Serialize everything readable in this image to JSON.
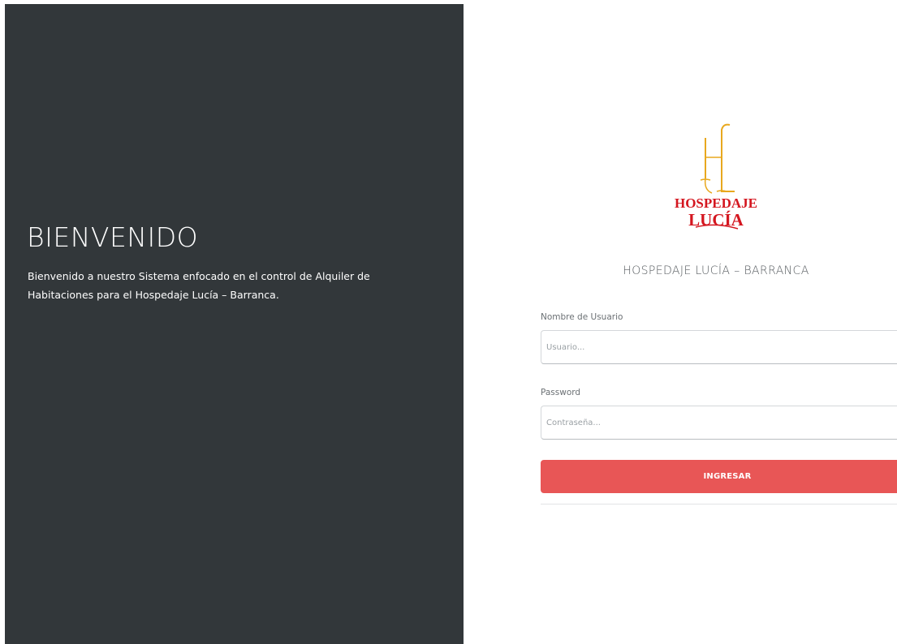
{
  "welcome": {
    "title": "BIENVENIDO",
    "text": "Bienvenido a nuestro Sistema enfocado en el control de Alquiler de Habitaciones para el Hospedaje Lucía – Barranca."
  },
  "logo": {
    "monogram": "HL",
    "line1": "HOSPEDAJE",
    "line2": "LUCÍA",
    "colors": {
      "monogram": "#e8a81e",
      "text": "#d4161f"
    }
  },
  "login": {
    "heading": "HOSPEDAJE LUCÍA – BARRANCA",
    "username_label": "Nombre de Usuario",
    "username_placeholder": "Usuario...",
    "username_value": "",
    "password_label": "Password",
    "password_placeholder": "Contraseña...",
    "password_value": "",
    "submit_label": "INGRESAR"
  },
  "colors": {
    "left_panel_bg": "#32373a",
    "button_bg": "#e85656"
  }
}
